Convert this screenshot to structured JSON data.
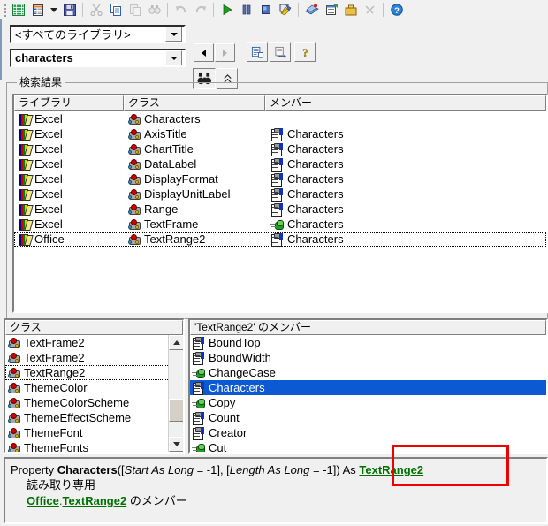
{
  "toolbar": {
    "items": [
      {
        "name": "view-excel-icon",
        "title": "Microsoft Excel の表示"
      },
      {
        "name": "insert-module-icon",
        "title": "ユーザー フォームの挿入"
      },
      {
        "name": "insert-dropdown-icon",
        "title": "挿入"
      },
      {
        "name": "save-icon",
        "title": "上書き保存"
      },
      {
        "name": "cut-icon",
        "title": "切り取り"
      },
      {
        "name": "copy-icon",
        "title": "コピー"
      },
      {
        "name": "paste-icon",
        "title": "貼り付け"
      },
      {
        "name": "find-icon",
        "title": "検索"
      },
      {
        "name": "undo-icon",
        "title": "元に戻す"
      },
      {
        "name": "redo-icon",
        "title": "やり直し"
      },
      {
        "name": "run-icon",
        "title": "Sub/ユーザー フォームの実行"
      },
      {
        "name": "break-icon",
        "title": "中断"
      },
      {
        "name": "reset-icon",
        "title": "リセット"
      },
      {
        "name": "design-mode-icon",
        "title": "デザイン モード"
      },
      {
        "name": "project-explorer-icon",
        "title": "プロジェクト エクスプローラー"
      },
      {
        "name": "properties-window-icon",
        "title": "プロパティ ウィンドウ"
      },
      {
        "name": "object-browser-icon",
        "title": "オブジェクト ブラウザー"
      },
      {
        "name": "toolbox-icon",
        "title": "ツールボックス"
      },
      {
        "name": "help-icon",
        "title": "ヘルプ"
      }
    ]
  },
  "search": {
    "library_value": "<すべてのライブラリ>",
    "search_value": "characters",
    "search_placeholder": "",
    "back_label": "◀",
    "forward_label": "▶",
    "copy_button": "copy-to-clipboard-icon",
    "view_definition_button": "view-definition-icon",
    "help_button": "help-icon",
    "search_button": "search-binoculars-icon",
    "toggle_results_button": "show-hide-search-results-icon"
  },
  "results": {
    "group_label": "検索結果",
    "columns": [
      "ライブラリ",
      "クラス",
      "メンバー"
    ],
    "rows": [
      {
        "library": "Excel",
        "class": "Characters",
        "member": "",
        "class_icon": "class-icon",
        "member_icon": "",
        "focused": false
      },
      {
        "library": "Excel",
        "class": "AxisTitle",
        "member": "Characters",
        "class_icon": "class-icon",
        "member_icon": "property-icon",
        "focused": false
      },
      {
        "library": "Excel",
        "class": "ChartTitle",
        "member": "Characters",
        "class_icon": "class-icon",
        "member_icon": "property-icon",
        "focused": false
      },
      {
        "library": "Excel",
        "class": "DataLabel",
        "member": "Characters",
        "class_icon": "class-icon",
        "member_icon": "property-icon",
        "focused": false
      },
      {
        "library": "Excel",
        "class": "DisplayFormat",
        "member": "Characters",
        "class_icon": "class-icon",
        "member_icon": "property-icon",
        "focused": false
      },
      {
        "library": "Excel",
        "class": "DisplayUnitLabel",
        "member": "Characters",
        "class_icon": "class-icon",
        "member_icon": "property-icon",
        "focused": false
      },
      {
        "library": "Excel",
        "class": "Range",
        "member": "Characters",
        "class_icon": "class-icon",
        "member_icon": "property-icon",
        "focused": false
      },
      {
        "library": "Excel",
        "class": "TextFrame",
        "member": "Characters",
        "class_icon": "class-icon",
        "member_icon": "method-icon",
        "focused": false
      },
      {
        "library": "Office",
        "class": "TextRange2",
        "member": "Characters",
        "class_icon": "class-icon",
        "member_icon": "property-icon",
        "focused": true
      }
    ]
  },
  "classes": {
    "header": "クラス",
    "items": [
      {
        "label": "TextFrame2",
        "icon": "class-icon",
        "selected": false
      },
      {
        "label": "TextFrame2",
        "icon": "class-icon",
        "selected": false
      },
      {
        "label": "TextRange2",
        "icon": "class-icon",
        "selected": true
      },
      {
        "label": "ThemeColor",
        "icon": "class-icon",
        "selected": false
      },
      {
        "label": "ThemeColorScheme",
        "icon": "class-icon",
        "selected": false
      },
      {
        "label": "ThemeEffectScheme",
        "icon": "class-icon",
        "selected": false
      },
      {
        "label": "ThemeFont",
        "icon": "class-icon",
        "selected": false
      },
      {
        "label": "ThemeFonts",
        "icon": "class-icon",
        "selected": false
      }
    ],
    "scroll_up": "scroll-up-arrow",
    "scroll_down": "scroll-down-arrow"
  },
  "members": {
    "header": "'TextRange2' のメンバー",
    "items": [
      {
        "label": "BoundTop",
        "icon": "property-icon",
        "selected": false
      },
      {
        "label": "BoundWidth",
        "icon": "property-icon",
        "selected": false
      },
      {
        "label": "ChangeCase",
        "icon": "method-icon",
        "selected": false
      },
      {
        "label": "Characters",
        "icon": "property-icon",
        "selected": true
      },
      {
        "label": "Copy",
        "icon": "method-icon",
        "selected": false
      },
      {
        "label": "Count",
        "icon": "property-icon",
        "selected": false
      },
      {
        "label": "Creator",
        "icon": "property-icon",
        "selected": false
      },
      {
        "label": "Cut",
        "icon": "method-icon",
        "selected": false
      }
    ]
  },
  "details": {
    "keyword": "Property",
    "member_name": "Characters",
    "open_paren": "([",
    "param1": "Start As Long",
    "param1_default": " = -1",
    "mid": "], [",
    "param2": "Length As Long",
    "param2_default": " = -1",
    "close_paren": "])",
    "as_keyword": "As",
    "return_type": "TextRange2",
    "readonly": "読み取り専用",
    "member_of_lib": "Office",
    "member_of_sep": ".",
    "member_of_class": "TextRange2",
    "member_of_suffix": " のメンバー"
  },
  "annotation": {
    "name": "red-highlight-box",
    "color": "#ee0000"
  },
  "colors": {
    "selection_blue": "#0b5ad4",
    "link_green": "#007000",
    "window_face": "#f0f0f0",
    "annotation_red": "#ee0000"
  }
}
